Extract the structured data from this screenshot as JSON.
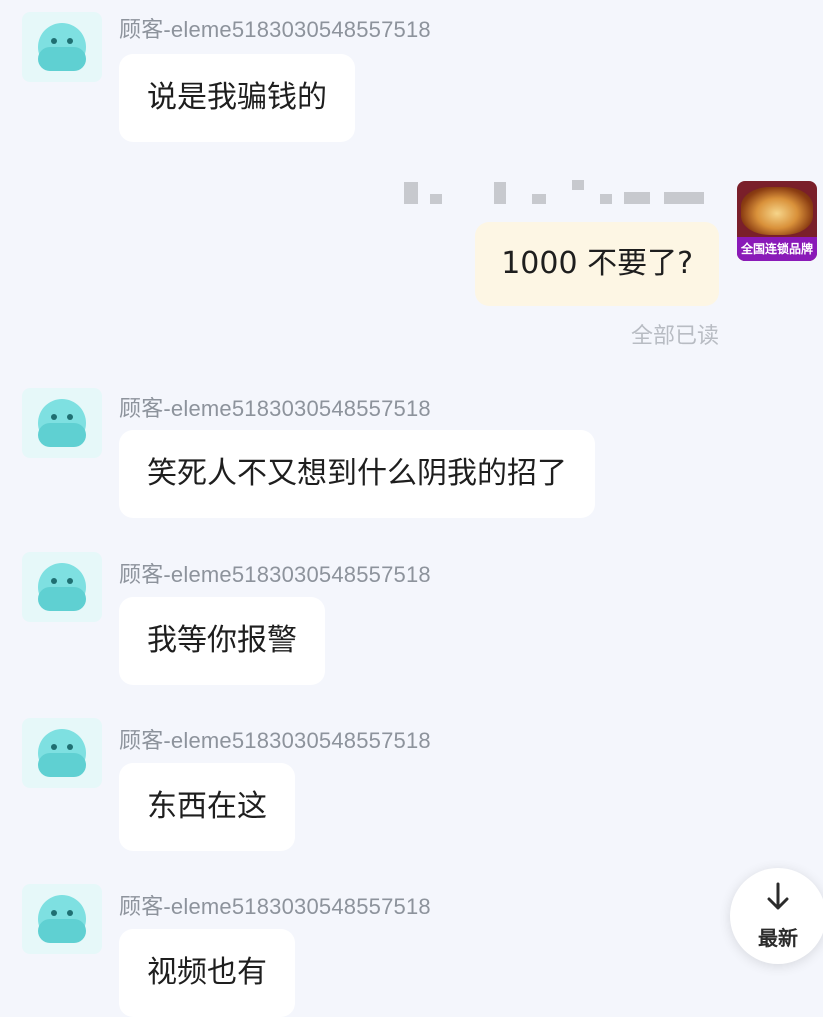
{
  "sender_name": "顾客-eleme5183030548557518",
  "messages_in": [
    {
      "text": "说是我骗钱的"
    },
    {
      "text": "笑死人不又想到什么阴我的招了"
    },
    {
      "text": "我等你报警"
    },
    {
      "text": "东西在这"
    },
    {
      "text": "视频也有"
    }
  ],
  "outgoing": {
    "text": "1000 不要了?",
    "status": "全部已读",
    "store_banner": "全国连锁品牌"
  },
  "fab": {
    "label": "最新",
    "icon": "arrow-down-icon"
  },
  "colors": {
    "background": "#f4f6fc",
    "bubble_in": "#ffffff",
    "bubble_out": "#fdf6e4",
    "avatar": "#7ee0e1"
  }
}
